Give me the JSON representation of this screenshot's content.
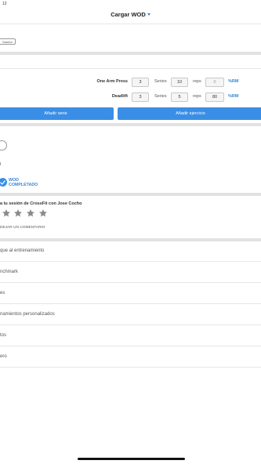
{
  "status_bar": {
    "time": "12"
  },
  "nav": {
    "title": "Cargar WOD"
  },
  "tag": {
    "label": "Samira"
  },
  "exercises": [
    {
      "name": "One Arm Press",
      "first": "3",
      "series_label": "Series",
      "reps_value": "10",
      "reps_label": "reps",
      "weight": "0",
      "rm_label": "%RM"
    },
    {
      "name": "Deadlift",
      "first": "3",
      "series_label": "Series",
      "reps_value": "5",
      "reps_label": "reps",
      "weight": "80",
      "rm_label": "%RM"
    }
  ],
  "buttons": {
    "add_series": "Añadir serie",
    "add_exercise": "Añadir ejercicio"
  },
  "small_letter": "I",
  "wod_completed": {
    "line1": "WOD",
    "line2": "COMPLETADO"
  },
  "rating": {
    "title": "a tu sesión de CrossFit con Jose Cocho",
    "stars_filled": 0,
    "stars_total": 5,
    "comment_link": "DEJAR UN COMENTARIO"
  },
  "menu": [
    {
      "label": "que al entrenamiento"
    },
    {
      "label": "nchmark"
    },
    {
      "label": "es"
    },
    {
      "label": "namientos personalizados"
    },
    {
      "label": "tos"
    },
    {
      "label": "ero"
    }
  ],
  "colors": {
    "accent": "#3a8ee6",
    "divider": "#e2e2e2"
  }
}
